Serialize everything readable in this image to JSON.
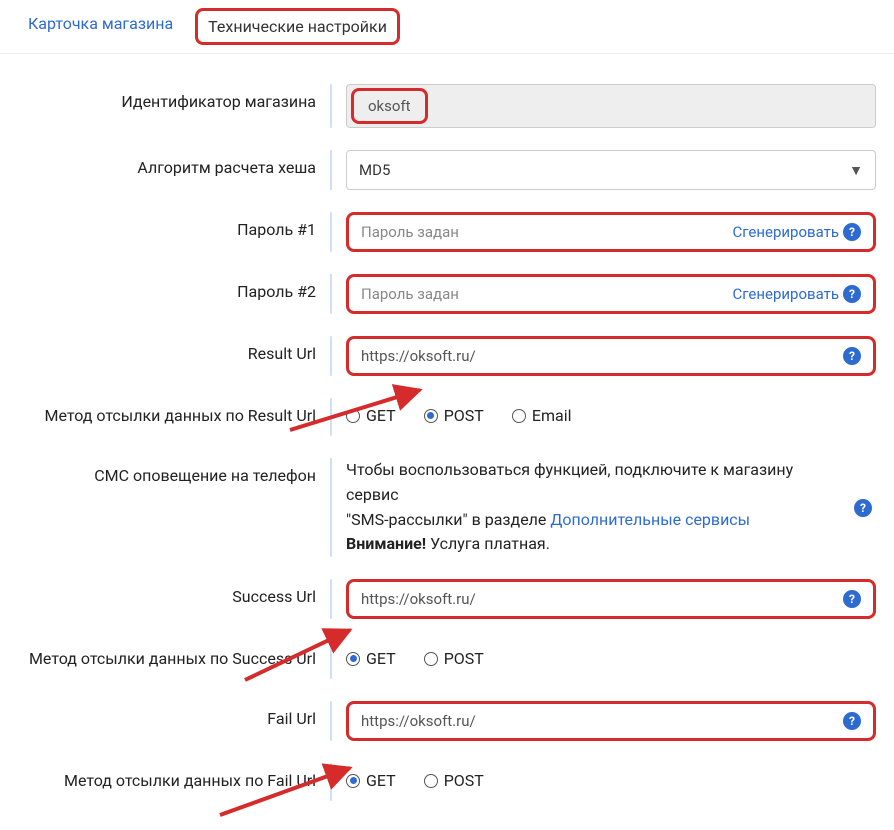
{
  "tabs": {
    "card": "Карточка магазина",
    "tech": "Технические настройки"
  },
  "labels": {
    "identifier": "Идентификатор магазина",
    "hash": "Алгоритм расчета хеша",
    "pass1": "Пароль #1",
    "pass2": "Пароль #2",
    "result_url": "Result Url",
    "result_method": "Метод отсылки данных по Result Url",
    "sms": "СМС оповещение на телефон",
    "success_url": "Success Url",
    "success_method": "Метод отсылки данных по Success Url",
    "fail_url": "Fail Url",
    "fail_method": "Метод отсылки данных по Fail Url"
  },
  "values": {
    "identifier": "oksoft",
    "hash": "MD5",
    "pass_placeholder": "Пароль задан",
    "result_url": "https://oksoft.ru/",
    "success_url": "https://oksoft.ru/",
    "fail_url": "https://oksoft.ru/"
  },
  "actions": {
    "generate": "Сгенерировать"
  },
  "radios": {
    "get": "GET",
    "post": "POST",
    "email": "Email"
  },
  "sms_notice": {
    "line1": "Чтобы воспользоваться функцией, подключите к магазину сервис",
    "line2a": "\"SMS-рассылки\" в разделе ",
    "link": "Дополнительные сервисы",
    "line3_bold": "Внимание!",
    "line3_rest": " Услуга платная."
  },
  "help_glyph": "?"
}
